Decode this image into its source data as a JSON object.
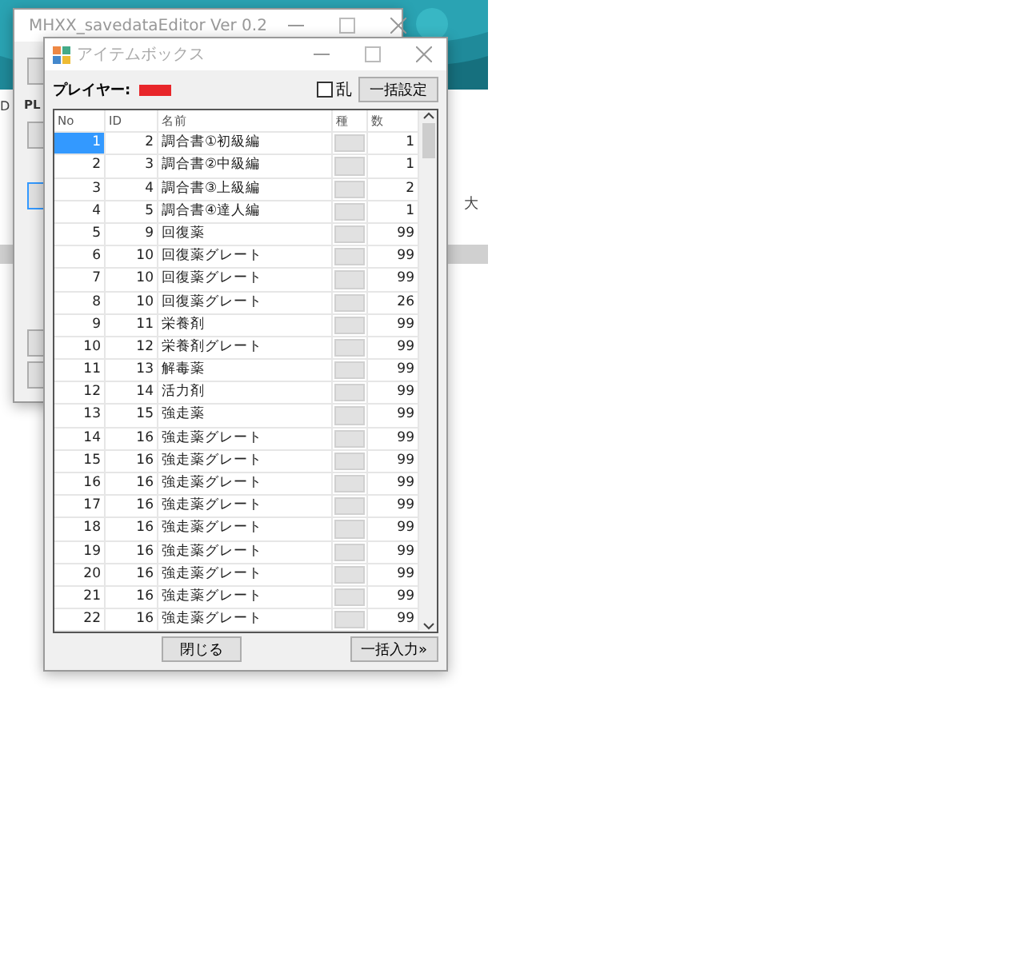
{
  "background": {
    "left_text": "D",
    "right_text": "大"
  },
  "main_window": {
    "title": "MHXX_savedataEditor Ver 0.2",
    "label": "PL"
  },
  "dialog": {
    "title": "アイテムボックス",
    "player_label": "プレイヤー:",
    "random": {
      "label": "乱",
      "checked": false
    },
    "set_all_button": "一括設定",
    "columns": [
      "No",
      "ID",
      "名前",
      "種",
      "数"
    ],
    "rows": [
      {
        "no": "1",
        "id": "2",
        "name": "調合書①初級編",
        "count": "1",
        "selected": true
      },
      {
        "no": "2",
        "id": "3",
        "name": "調合書②中級編",
        "count": "1",
        "selected": false
      },
      {
        "no": "3",
        "id": "4",
        "name": "調合書③上級編",
        "count": "2",
        "selected": false
      },
      {
        "no": "4",
        "id": "5",
        "name": "調合書④達人編",
        "count": "1",
        "selected": false
      },
      {
        "no": "5",
        "id": "9",
        "name": "回復薬",
        "count": "99",
        "selected": false
      },
      {
        "no": "6",
        "id": "10",
        "name": "回復薬グレート",
        "count": "99",
        "selected": false
      },
      {
        "no": "7",
        "id": "10",
        "name": "回復薬グレート",
        "count": "99",
        "selected": false
      },
      {
        "no": "8",
        "id": "10",
        "name": "回復薬グレート",
        "count": "26",
        "selected": false
      },
      {
        "no": "9",
        "id": "11",
        "name": "栄養剤",
        "count": "99",
        "selected": false
      },
      {
        "no": "10",
        "id": "12",
        "name": "栄養剤グレート",
        "count": "99",
        "selected": false
      },
      {
        "no": "11",
        "id": "13",
        "name": "解毒薬",
        "count": "99",
        "selected": false
      },
      {
        "no": "12",
        "id": "14",
        "name": "活力剤",
        "count": "99",
        "selected": false
      },
      {
        "no": "13",
        "id": "15",
        "name": "強走薬",
        "count": "99",
        "selected": false
      },
      {
        "no": "14",
        "id": "16",
        "name": "強走薬グレート",
        "count": "99",
        "selected": false
      },
      {
        "no": "15",
        "id": "16",
        "name": "強走薬グレート",
        "count": "99",
        "selected": false
      },
      {
        "no": "16",
        "id": "16",
        "name": "強走薬グレート",
        "count": "99",
        "selected": false
      },
      {
        "no": "17",
        "id": "16",
        "name": "強走薬グレート",
        "count": "99",
        "selected": false
      },
      {
        "no": "18",
        "id": "16",
        "name": "強走薬グレート",
        "count": "99",
        "selected": false
      },
      {
        "no": "19",
        "id": "16",
        "name": "強走薬グレート",
        "count": "99",
        "selected": false
      },
      {
        "no": "20",
        "id": "16",
        "name": "強走薬グレート",
        "count": "99",
        "selected": false
      },
      {
        "no": "21",
        "id": "16",
        "name": "強走薬グレート",
        "count": "99",
        "selected": false
      },
      {
        "no": "22",
        "id": "16",
        "name": "強走薬グレート",
        "count": "99",
        "selected": false
      }
    ],
    "close_button": "閉じる",
    "insert_all_button": "一括入力»"
  }
}
